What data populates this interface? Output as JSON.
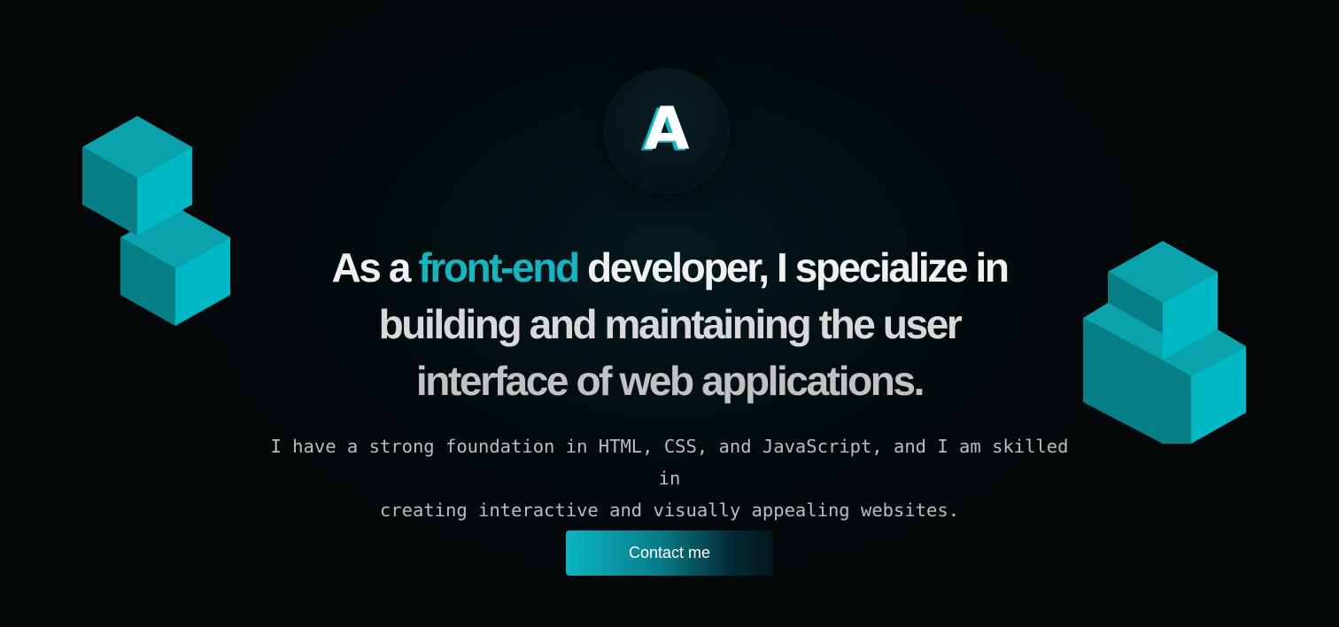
{
  "logo": {
    "letter": "A"
  },
  "headline": {
    "line1_before": "As a ",
    "line1_accent": "front-end",
    "line1_after": " developer, I specialize in",
    "line2": "building and maintaining the user",
    "line3": "interface of web applications."
  },
  "subtext": {
    "line1": "I have a strong foundation in HTML, CSS, and JavaScript, and I am skilled in",
    "line2": "creating interactive and visually appealing websites."
  },
  "cta": {
    "label": "Contact me"
  },
  "colors": {
    "accent": "#16b4bf",
    "background": "#030708",
    "cube_top": "#0aa3ad",
    "cube_left": "#077f87",
    "cube_right": "#00b9c4"
  },
  "decorations": {
    "left_icon": "stacked-cubes-icon",
    "right_icon": "stacked-cubes-icon"
  }
}
